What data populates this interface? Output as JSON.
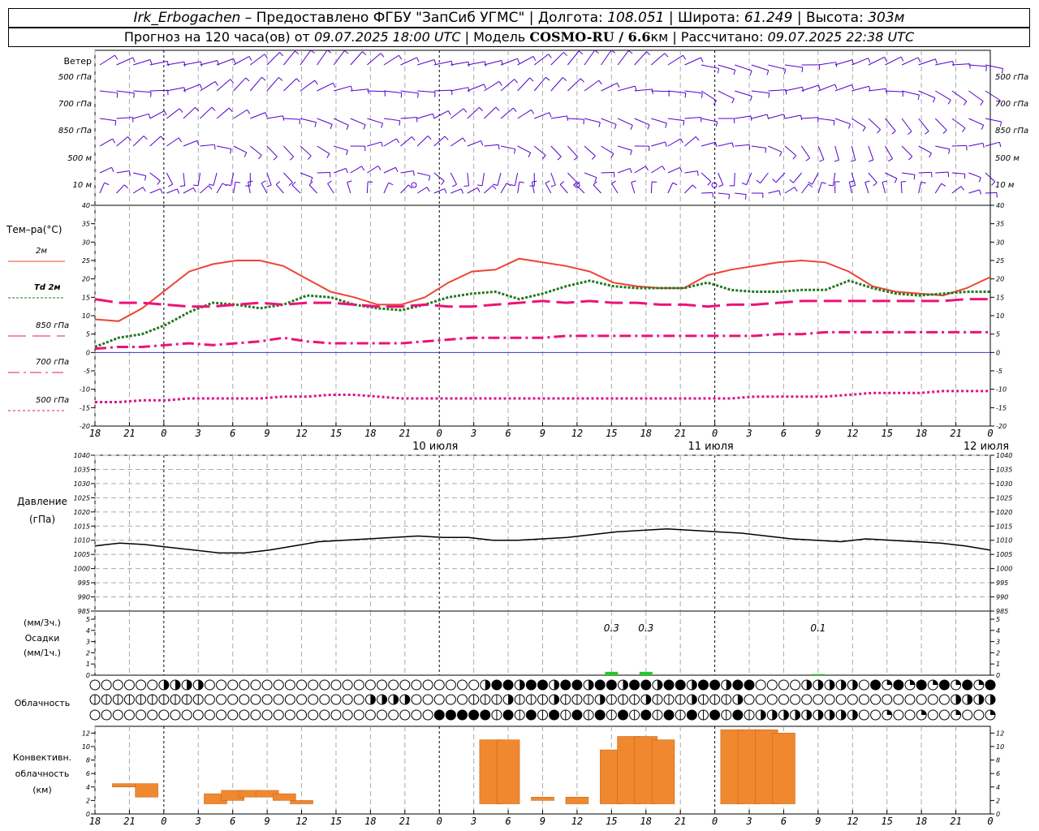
{
  "header": {
    "station": "Irk_Erbogachen",
    "provider": "– Предоставлено ФГБУ \"ЗапСиб УГМС\"",
    "lon_label": "| Долгота:",
    "lon": "108.051",
    "lat_label": "| Широта:",
    "lat": "61.249",
    "alt_label": "| Высота:",
    "alt": "303м",
    "forecast_label": "Прогноз на 120 часа(ов) от",
    "forecast_start": "09.07.2025 18:00 UTC",
    "model_label": "| Модель",
    "model": "COSMO-RU / 6.6",
    "model_unit": "км",
    "calc_label": "| Рассчитано:",
    "calc_time": "09.07.2025 22:38 UTC"
  },
  "labels": {
    "wind": "Ветер",
    "wind_levels": [
      "500 гПа",
      "700 гПа",
      "850 гПа",
      "500 м",
      "10  м"
    ],
    "temp_title": "Тем–ра(°С)",
    "legend": [
      "2м",
      "Td 2м",
      "850 гПа",
      "700 гПа",
      "500 гПа"
    ],
    "pressure_title": [
      "Давление",
      "(гПа)"
    ],
    "precip_title": [
      "(мм/3ч.)",
      "Осадки",
      "(мм/1ч.)"
    ],
    "cloud_title": "Облачность",
    "conv_title": [
      "Конвективн.",
      "облачность",
      "(км)"
    ],
    "dates": [
      "10 июля",
      "11 июля",
      "12 июля"
    ]
  },
  "colors": {
    "t2m": "#ee4433",
    "td2m": "#227722",
    "t850": "#ee1177",
    "t700": "#ee1177",
    "t500": "#dd1188",
    "wind": "#5500cc",
    "precip": "#22cc22",
    "conv": "#f08830",
    "grid": "#aaaaaa"
  },
  "chart_data": [
    {
      "type": "line",
      "x_ticks": [
        "18",
        "21",
        "0",
        "3",
        "6",
        "9",
        "12",
        "15",
        "18",
        "21",
        "0",
        "3",
        "6",
        "9",
        "12",
        "15",
        "18",
        "21",
        "0",
        "3",
        "6",
        "9",
        "12",
        "15",
        "18",
        "21",
        "0"
      ],
      "y_ticks": [
        -20,
        -15,
        -10,
        -5,
        0,
        5,
        10,
        15,
        20,
        25,
        30,
        35,
        40
      ],
      "ylim": [
        -20,
        40
      ],
      "x_hours": [
        0,
        3,
        6,
        9,
        12,
        15,
        18,
        21,
        24,
        27,
        30,
        33,
        36,
        39,
        42,
        45,
        48,
        51,
        54,
        57,
        60,
        63,
        66,
        69,
        72,
        75,
        78
      ],
      "series": [
        {
          "name": "2м",
          "values": [
            9,
            8.5,
            12,
            17,
            22,
            24,
            25,
            25,
            23.5,
            20,
            16.5,
            15,
            13,
            13,
            15,
            19,
            22,
            22.5,
            25.5,
            24.5,
            23.5,
            22,
            19,
            18,
            17.5,
            17.5,
            21,
            22.5,
            23.5,
            24.5,
            25,
            24.5,
            22,
            18,
            16.5,
            16,
            15.5,
            17.5,
            20.5
          ]
        },
        {
          "name": "Td 2м",
          "values": [
            1.5,
            4,
            5,
            7.5,
            11,
            13.5,
            13,
            12,
            13,
            15.5,
            15,
            13,
            12,
            11.5,
            13,
            15,
            16,
            16.5,
            14.5,
            16,
            18,
            19.5,
            18,
            17.5,
            17.5,
            17.5,
            19,
            17,
            16.5,
            16.5,
            17,
            17,
            19.5,
            17.5,
            16,
            15.5,
            16,
            16.5,
            16.5
          ]
        },
        {
          "name": "850 гПа",
          "values": [
            14.5,
            13.5,
            13.5,
            13,
            12.5,
            12.5,
            13,
            13.5,
            13,
            13.5,
            13.5,
            13,
            12.5,
            12.5,
            13,
            12.5,
            12.5,
            13,
            13.5,
            14,
            13.5,
            14,
            13.5,
            13.5,
            13,
            13,
            12.5,
            13,
            13,
            13.5,
            14,
            14,
            14,
            14,
            14,
            14,
            14,
            14.5,
            14.5
          ]
        },
        {
          "name": "700 гПа",
          "values": [
            1,
            1.5,
            1.5,
            2,
            2.5,
            2,
            2.5,
            3,
            4,
            3,
            2.5,
            2.5,
            2.5,
            2.5,
            3,
            3.5,
            4,
            4,
            4,
            4,
            4.5,
            4.5,
            4.5,
            4.5,
            4.5,
            4.5,
            4.5,
            4.5,
            4.5,
            5,
            5,
            5.5,
            5.5,
            5.5,
            5.5,
            5.5,
            5.5,
            5.5,
            5.5
          ]
        },
        {
          "name": "500 гПа",
          "values": [
            -13.5,
            -13.5,
            -13,
            -13,
            -12.5,
            -12.5,
            -12.5,
            -12.5,
            -12,
            -12,
            -11.5,
            -11.5,
            -12,
            -12.5,
            -12.5,
            -12.5,
            -12.5,
            -12.5,
            -12.5,
            -12.5,
            -12.5,
            -12.5,
            -12.5,
            -12.5,
            -12.5,
            -12.5,
            -12.5,
            -12.5,
            -12,
            -12,
            -12,
            -12,
            -11.5,
            -11,
            -11,
            -11,
            -10.5,
            -10.5,
            -10.5
          ]
        }
      ]
    },
    {
      "type": "line",
      "y_ticks": [
        985,
        990,
        995,
        1000,
        1005,
        1010,
        1015,
        1020,
        1025,
        1030,
        1035,
        1040
      ],
      "ylim": [
        985,
        1040
      ],
      "series": [
        {
          "name": "Давление",
          "values": [
            1008,
            1009,
            1008.5,
            1007.5,
            1006.5,
            1005.5,
            1005.5,
            1006.5,
            1008,
            1009.5,
            1010,
            1010.5,
            1011,
            1011.5,
            1011,
            1011,
            1010,
            1010,
            1010.5,
            1011,
            1012,
            1013,
            1013.5,
            1014,
            1013.5,
            1013,
            1012.5,
            1011.5,
            1010.5,
            1010,
            1009.5,
            1010.5,
            1010,
            1009.5,
            1009,
            1008,
            1006.5
          ]
        }
      ]
    },
    {
      "type": "bar",
      "y_ticks": [
        0,
        1,
        2,
        3,
        4,
        5
      ],
      "ylim": [
        0,
        5
      ],
      "bars": [
        {
          "hour": 45,
          "value": 0.3
        },
        {
          "hour": 48,
          "value": 0.3
        },
        {
          "hour": 63,
          "value": 0.1
        }
      ],
      "annotations": [
        {
          "hour": 45,
          "text": "0.3"
        },
        {
          "hour": 48,
          "text": "0.3"
        },
        {
          "hour": 63,
          "text": "0.1"
        }
      ]
    },
    {
      "type": "bar",
      "y_ticks": [
        0,
        2,
        4,
        6,
        8,
        10,
        12
      ],
      "ylim": [
        0,
        13
      ],
      "bars": [
        {
          "hour": 2.5,
          "bottom": 4,
          "top": 4.5
        },
        {
          "hour": 4.5,
          "bottom": 2.5,
          "top": 4.5
        },
        {
          "hour": 10.5,
          "bottom": 1.5,
          "top": 3
        },
        {
          "hour": 12,
          "bottom": 2,
          "top": 3.5
        },
        {
          "hour": 13.5,
          "bottom": 2.5,
          "top": 3.5
        },
        {
          "hour": 15,
          "bottom": 2.5,
          "top": 3.5
        },
        {
          "hour": 16.5,
          "bottom": 2,
          "top": 3
        },
        {
          "hour": 18,
          "bottom": 1.5,
          "top": 2
        },
        {
          "hour": 34.5,
          "bottom": 1.5,
          "top": 11
        },
        {
          "hour": 36,
          "bottom": 1.5,
          "top": 11
        },
        {
          "hour": 39,
          "bottom": 2,
          "top": 2.5
        },
        {
          "hour": 42,
          "bottom": 1.5,
          "top": 2.5
        },
        {
          "hour": 45,
          "bottom": 1.5,
          "top": 9.5
        },
        {
          "hour": 46.5,
          "bottom": 1.5,
          "top": 11.5
        },
        {
          "hour": 48,
          "bottom": 1.5,
          "top": 11.5
        },
        {
          "hour": 49.5,
          "bottom": 1.5,
          "top": 11
        },
        {
          "hour": 55.5,
          "bottom": 1.5,
          "top": 12.5
        },
        {
          "hour": 57,
          "bottom": 1.5,
          "top": 12.5
        },
        {
          "hour": 58.5,
          "bottom": 1.5,
          "top": 12.5
        },
        {
          "hour": 60,
          "bottom": 1.5,
          "top": 12
        }
      ]
    }
  ]
}
